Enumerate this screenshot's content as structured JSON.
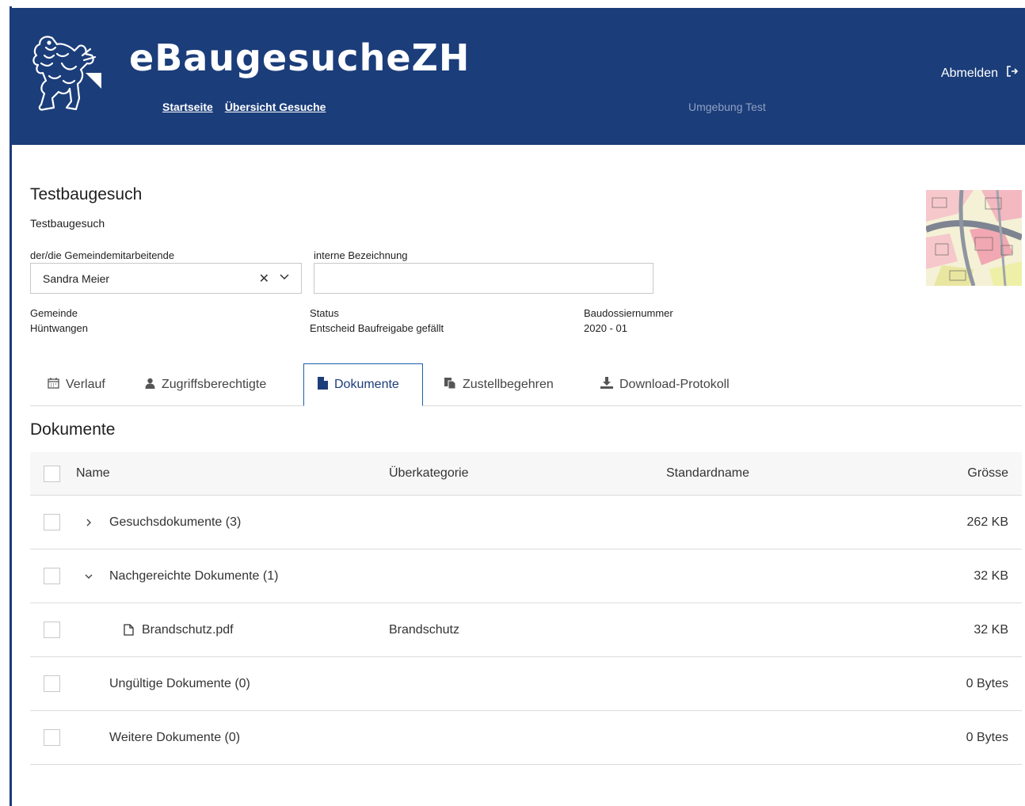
{
  "header": {
    "app_title": "eBaugesucheZH",
    "nav": [
      "Startseite",
      "Übersicht Gesuche"
    ],
    "environment": "Umgebung Test",
    "logout_label": "Abmelden",
    "logo_icon": "zurich-lion-logo-icon"
  },
  "gesuch": {
    "title": "Testbaugesuch",
    "subtitle": "Testbaugesuch",
    "employee_label": "der/die Gemeindemitarbeitende",
    "employee_value": "Sandra Meier",
    "internal_label": "interne Bezeichnung",
    "internal_value": "",
    "gemeinde_label": "Gemeinde",
    "gemeinde_value": "Hüntwangen",
    "status_label": "Status",
    "status_value": "Entscheid Baufreigabe gefällt",
    "dossier_label": "Baudossiernummer",
    "dossier_value": "2020 - 01"
  },
  "tabs": [
    {
      "label": "Verlauf",
      "icon": "calendar-icon"
    },
    {
      "label": "Zugriffsberechtigte",
      "icon": "user-icon"
    },
    {
      "label": "Dokumente",
      "icon": "document-icon",
      "active": true
    },
    {
      "label": "Zustellbegehren",
      "icon": "copy-icon"
    },
    {
      "label": "Download-Protokoll",
      "icon": "download-icon"
    }
  ],
  "documents": {
    "section_title": "Dokumente",
    "columns": [
      "Name",
      "Überkategorie",
      "Standardname",
      "Grösse"
    ],
    "rows": [
      {
        "name": "Gesuchsdokumente (3)",
        "category": "",
        "standard": "",
        "size": "262 KB",
        "toggle": "collapsed"
      },
      {
        "name": "Nachgereichte Dokumente (1)",
        "category": "",
        "standard": "",
        "size": "32 KB",
        "toggle": "expanded"
      },
      {
        "name": "Brandschutz.pdf",
        "category": "Brandschutz",
        "standard": "",
        "size": "32 KB",
        "file": true
      },
      {
        "name": "Ungültige Dokumente (0)",
        "category": "",
        "standard": "",
        "size": "0 Bytes"
      },
      {
        "name": "Weitere Dokumente (0)",
        "category": "",
        "standard": "",
        "size": "0 Bytes"
      }
    ]
  },
  "colors": {
    "header_bg": "#1b3d7a",
    "active_tab_border": "#1b5fa8"
  }
}
